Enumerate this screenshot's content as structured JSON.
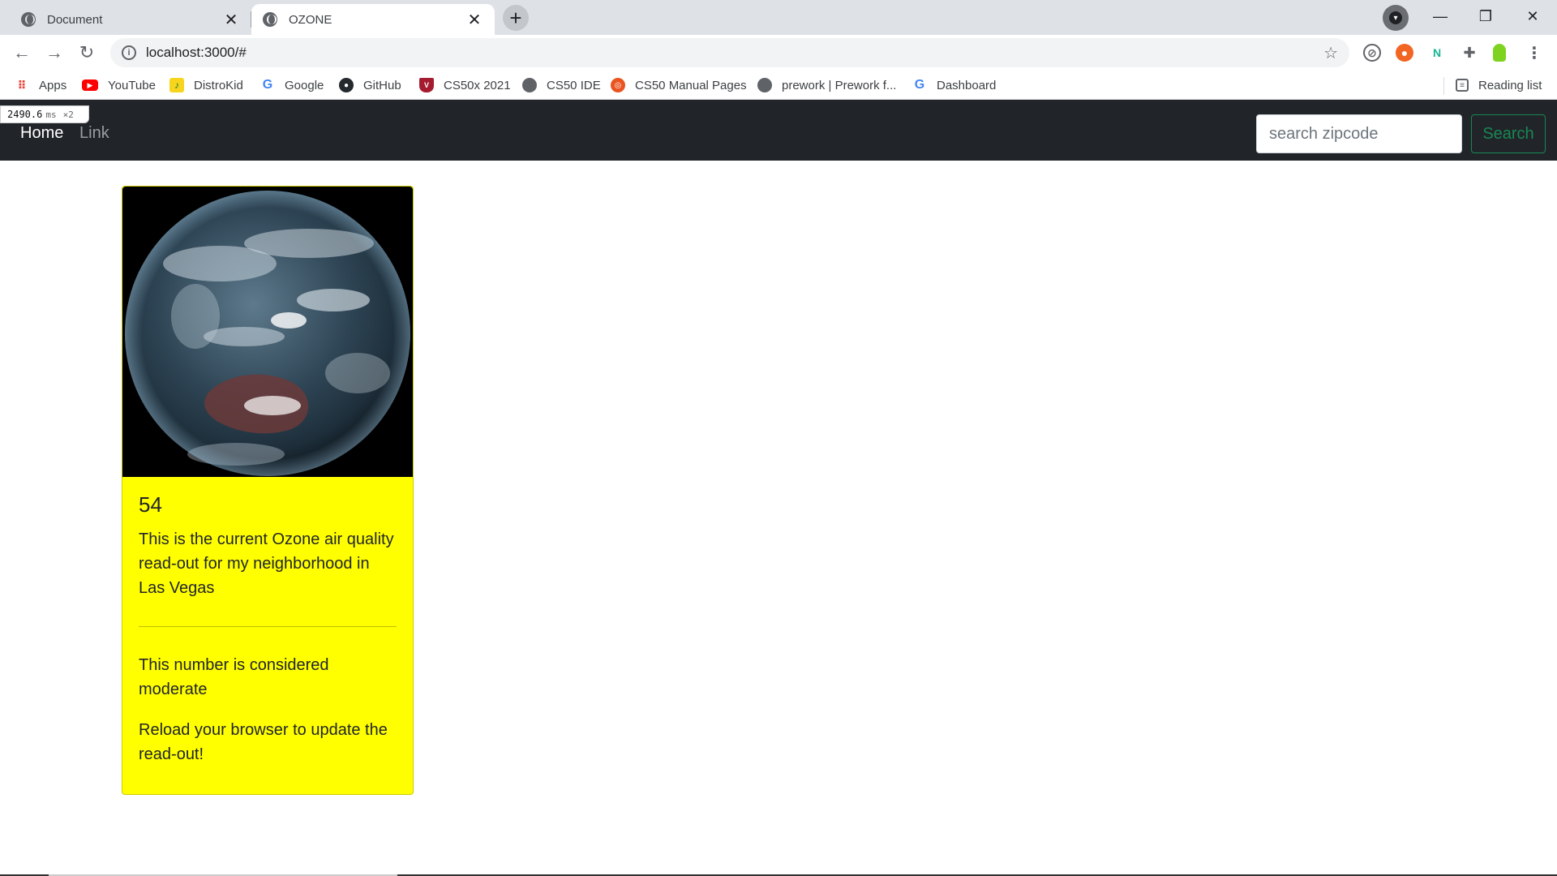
{
  "browser": {
    "tabs": [
      {
        "title": "Document",
        "active": false
      },
      {
        "title": "OZONE",
        "active": true
      }
    ],
    "url": "localhost:3000/#",
    "bookmarks": [
      {
        "label": "Apps",
        "icon": "apps-grid-icon"
      },
      {
        "label": "YouTube",
        "icon": "youtube-icon"
      },
      {
        "label": "DistroKid",
        "icon": "distrokid-icon"
      },
      {
        "label": "Google",
        "icon": "google-icon"
      },
      {
        "label": "GitHub",
        "icon": "github-icon"
      },
      {
        "label": "CS50x 2021",
        "icon": "harvard-shield-icon"
      },
      {
        "label": "CS50 IDE",
        "icon": "globe-icon"
      },
      {
        "label": "CS50 Manual Pages",
        "icon": "ubuntu-icon"
      },
      {
        "label": "prework | Prework f...",
        "icon": "globe-icon"
      },
      {
        "label": "Dashboard",
        "icon": "google-icon"
      }
    ],
    "reading_list": "Reading list"
  },
  "perf": {
    "value": "2490.6",
    "unit": "ms",
    "multiplier": "×2"
  },
  "app": {
    "nav": {
      "home": "Home",
      "link": "Link"
    },
    "search": {
      "placeholder": "search zipcode",
      "button": "Search"
    },
    "card": {
      "image_alt": "Earth from space",
      "value": "54",
      "description": "This is the current Ozone air quality read-out for my neighborhood in Las Vegas",
      "category_text": "This number is considered moderate",
      "reload_text": "Reload your browser to update the read-out!",
      "background": "#ffff00"
    }
  },
  "colors": {
    "navbar": "#212529",
    "search_button": "#198754",
    "tabstrip": "#dee1e6"
  }
}
